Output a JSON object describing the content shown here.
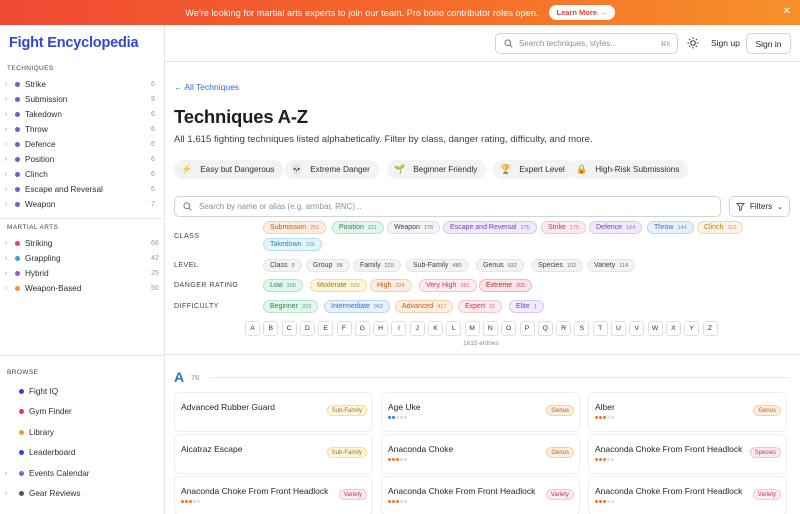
{
  "banner": {
    "message": "We're looking for martial arts experts to join our team. Pro bono contributor roles open.",
    "button": "Learn More →",
    "close": "✕"
  },
  "sidebar": {
    "brand": "Fight Encyclopedia",
    "techniques_title": "TECHNIQUES",
    "techniques": [
      {
        "label": "Strike",
        "count": "6",
        "color": "#6b5fd6"
      },
      {
        "label": "Submission",
        "count": "9",
        "color": "#6b5fd6"
      },
      {
        "label": "Takedown",
        "count": "6",
        "color": "#6b5fd6"
      },
      {
        "label": "Throw",
        "count": "6",
        "color": "#6b5fd6"
      },
      {
        "label": "Defence",
        "count": "6",
        "color": "#6b5fd6"
      },
      {
        "label": "Position",
        "count": "6",
        "color": "#6b5fd6"
      },
      {
        "label": "Clinch",
        "count": "6",
        "color": "#6b5fd6"
      },
      {
        "label": "Escape and Reversal",
        "count": "6",
        "color": "#6b5fd6"
      },
      {
        "label": "Weapon",
        "count": "7",
        "color": "#6b5fd6"
      }
    ],
    "martial_title": "MARTIAL ARTS",
    "martial": [
      {
        "label": "Striking",
        "count": "66",
        "color": "#e0457b"
      },
      {
        "label": "Grappling",
        "count": "42",
        "color": "#3aa0d8"
      },
      {
        "label": "Hybrid",
        "count": "25",
        "color": "#8a5cd6"
      },
      {
        "label": "Weapon-Based",
        "count": "50",
        "color": "#f0922e"
      }
    ],
    "browse_title": "BROWSE",
    "browse": [
      {
        "label": "Fight IQ",
        "color": "#2f47d8",
        "chev": ""
      },
      {
        "label": "Gym Finder",
        "color": "#e23b3b",
        "chev": ""
      },
      {
        "label": "Library",
        "color": "#f0a020",
        "chev": ""
      },
      {
        "label": "Leaderboard",
        "color": "#2f47d8",
        "chev": ""
      },
      {
        "label": "Events Calendar",
        "color": "#8a5cd6",
        "chev": "›"
      },
      {
        "label": "Gear Reviews",
        "color": "#555555",
        "chev": "›"
      }
    ]
  },
  "topbar": {
    "search_placeholder": "Search techniques, styles...",
    "shortcut": "⌘K",
    "signup": "Sign up",
    "signin": "Sign in"
  },
  "main": {
    "back": "← All Techniques",
    "title": "Techniques A-Z",
    "subtitle": "All 1,615 fighting techniques listed alphabetically. Filter by class, danger rating, difficulty, and more.",
    "chips": [
      {
        "icon": "⚡",
        "label": "Easy but Dangerous"
      },
      {
        "icon": "💀",
        "label": "Extreme Danger"
      },
      {
        "icon": "🌱",
        "label": "Beginner Friendly"
      },
      {
        "icon": "🏆",
        "label": "Expert Level"
      },
      {
        "icon": "🔒",
        "label": "High-Risk Submissions"
      }
    ],
    "filter_placeholder": "Search by name or alias (e.g. armbar, RNC)...",
    "filters_label": "Filters",
    "class_label": "CLASS",
    "class_pills": [
      {
        "label": "Submission",
        "n": "251",
        "bg": "#fdeee0",
        "fg": "#c25a1a",
        "bd": "#f6cfae"
      },
      {
        "label": "Position",
        "n": "211",
        "bg": "#e3f6ec",
        "fg": "#23864f",
        "bd": "#b6e3c9"
      },
      {
        "label": "Weapon",
        "n": "176",
        "bg": "#f2f3f5",
        "fg": "#3c4146",
        "bd": "#dcdfe3"
      },
      {
        "label": "Escape and Reversal",
        "n": "175",
        "bg": "#f1ebfd",
        "fg": "#6b3fcf",
        "bd": "#d6c6f6"
      },
      {
        "label": "Strike",
        "n": "175",
        "bg": "#fdecef",
        "fg": "#c8334b",
        "bd": "#f5c3cc"
      },
      {
        "label": "Defence",
        "n": "164",
        "bg": "#f1ebfd",
        "fg": "#6b3fcf",
        "bd": "#d6c6f6"
      },
      {
        "label": "Throw",
        "n": "144",
        "bg": "#e6f1fd",
        "fg": "#2f6fd6",
        "bd": "#bcd6f5"
      },
      {
        "label": "Clinch",
        "n": "113",
        "bg": "#fdf3e2",
        "fg": "#c2761a",
        "bd": "#f3d8a8"
      },
      {
        "label": "Takedown",
        "n": "106",
        "bg": "#e4f4fb",
        "fg": "#1f86b8",
        "bd": "#b5def0"
      }
    ],
    "level_label": "LEVEL",
    "level_pills": [
      {
        "label": "Class",
        "n": "9"
      },
      {
        "label": "Group",
        "n": "58"
      },
      {
        "label": "Family",
        "n": "229"
      },
      {
        "label": "Sub-Family",
        "n": "480"
      },
      {
        "label": "Genus",
        "n": "632"
      },
      {
        "label": "Species",
        "n": "102"
      },
      {
        "label": "Variety",
        "n": "114"
      }
    ],
    "danger_label": "DANGER RATING",
    "danger_pills": [
      {
        "label": "Low",
        "n": "206",
        "bg": "#e3f6ec",
        "fg": "#23864f",
        "bd": "#b6e3c9"
      },
      {
        "label": "Moderate",
        "n": "502",
        "bg": "#fdf6dc",
        "fg": "#a3790e",
        "bd": "#f1dea2"
      },
      {
        "label": "High",
        "n": "324",
        "bg": "#fdeee0",
        "fg": "#c25a1a",
        "bd": "#f6cfae"
      },
      {
        "label": "Very High",
        "n": "281",
        "bg": "#fdecef",
        "fg": "#c8334b",
        "bd": "#f5c3cc"
      },
      {
        "label": "Extreme",
        "n": "205",
        "bg": "#fbe3e6",
        "fg": "#b3263c",
        "bd": "#f0b3bd"
      }
    ],
    "difficulty_label": "DIFFICULTY",
    "difficulty_pills": [
      {
        "label": "Beginner",
        "n": "203",
        "bg": "#e3f6ec",
        "fg": "#23864f",
        "bd": "#b6e3c9"
      },
      {
        "label": "Intermediate",
        "n": "962",
        "bg": "#e6f1fd",
        "fg": "#2f6fd6",
        "bd": "#bcd6f5"
      },
      {
        "label": "Advanced",
        "n": "417",
        "bg": "#fdeee0",
        "fg": "#c25a1a",
        "bd": "#f6cfae"
      },
      {
        "label": "Expert",
        "n": "31",
        "bg": "#fdecef",
        "fg": "#c8334b",
        "bd": "#f5c3cc"
      },
      {
        "label": "Elite",
        "n": "1",
        "bg": "#f1ebfd",
        "fg": "#6b3fcf",
        "bd": "#d6c6f6"
      }
    ],
    "letters": [
      "A",
      "B",
      "C",
      "D",
      "E",
      "F",
      "G",
      "H",
      "I",
      "J",
      "K",
      "L",
      "M",
      "N",
      "O",
      "P",
      "Q",
      "R",
      "S",
      "T",
      "U",
      "V",
      "W",
      "X",
      "Y",
      "Z"
    ],
    "entries": "1615 entries",
    "section_letter": "A",
    "section_count": "76",
    "cards": [
      {
        "name": "Advanced Rubber Guard",
        "badge": "Sub-Family",
        "btype": "sub",
        "dots": ""
      },
      {
        "name": "Age Uke",
        "badge": "Genus",
        "btype": "genus",
        "dots": "blue"
      },
      {
        "name": "Alber",
        "badge": "Genus",
        "btype": "genus",
        "dots": "orange"
      },
      {
        "name": "Alcatraz Escape",
        "badge": "Sub-Family",
        "btype": "sub",
        "dots": ""
      },
      {
        "name": "Anaconda Choke",
        "badge": "Genus",
        "btype": "genus",
        "dots": "orange"
      },
      {
        "name": "Anaconda Choke From Front Headlock",
        "badge": "Species",
        "btype": "species",
        "dots": "orange"
      },
      {
        "name": "Anaconda Choke From Front Headlock ...",
        "badge": "Variety",
        "btype": "variety",
        "dots": "orange"
      },
      {
        "name": "Anaconda Choke From Front Headlock ...",
        "badge": "Variety",
        "btype": "variety",
        "dots": "orange"
      },
      {
        "name": "Anaconda Choke From Front Headlock ...",
        "badge": "Variety",
        "btype": "variety",
        "dots": "orange"
      }
    ]
  }
}
